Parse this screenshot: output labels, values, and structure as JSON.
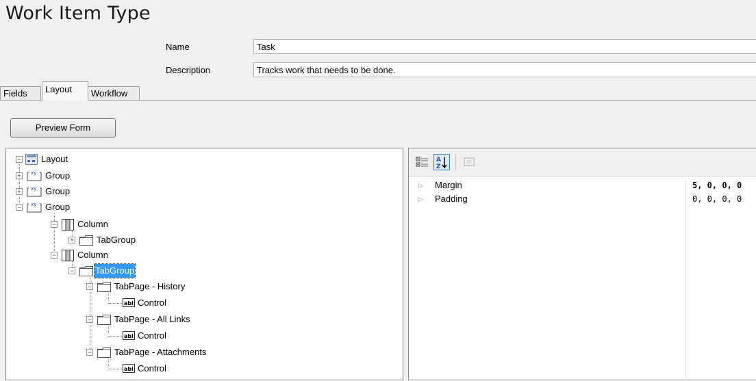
{
  "header": {
    "title": "Work Item Type",
    "name_label": "Name",
    "name_value": "Task",
    "description_label": "Description",
    "description_value": "Tracks work that needs to be done."
  },
  "tabs": [
    {
      "label": "Fields",
      "active": false
    },
    {
      "label": "Layout",
      "active": true
    },
    {
      "label": "Workflow",
      "active": false
    }
  ],
  "preview_button": "Preview Form",
  "tree": {
    "nodes": [
      {
        "label": "Layout",
        "icon": "layout-icon",
        "expander": "minus"
      },
      {
        "label": "Group",
        "icon": "group-icon",
        "expander": "plus"
      },
      {
        "label": "Group",
        "icon": "group-icon",
        "expander": "plus"
      },
      {
        "label": "Group",
        "icon": "group-icon",
        "expander": "minus"
      },
      {
        "label": "Column",
        "icon": "column-icon",
        "expander": "minus"
      },
      {
        "label": "TabGroup",
        "icon": "tabgroup-icon",
        "expander": "plus"
      },
      {
        "label": "Column",
        "icon": "column-icon",
        "expander": "minus"
      },
      {
        "label": "TabGroup",
        "icon": "tabgroup-icon",
        "expander": "minus",
        "selected": true
      },
      {
        "label": "TabPage - History",
        "icon": "tabpage-icon",
        "expander": "minus"
      },
      {
        "label": "Control",
        "icon": "control-icon",
        "expander": "none"
      },
      {
        "label": "TabPage - All Links",
        "icon": "tabpage-icon",
        "expander": "minus"
      },
      {
        "label": "Control",
        "icon": "control-icon",
        "expander": "none"
      },
      {
        "label": "TabPage - Attachments",
        "icon": "tabpage-icon",
        "expander": "minus"
      },
      {
        "label": "Control",
        "icon": "control-icon",
        "expander": "none"
      }
    ]
  },
  "properties": {
    "toolbar": [
      "categorized-icon",
      "alphabetical-icon",
      "property-pages-icon"
    ],
    "rows": [
      {
        "name": "Margin",
        "value": "5, 0, 0, 0",
        "bold": true
      },
      {
        "name": "Padding",
        "value": "0, 0, 0, 0",
        "bold": false
      }
    ]
  }
}
